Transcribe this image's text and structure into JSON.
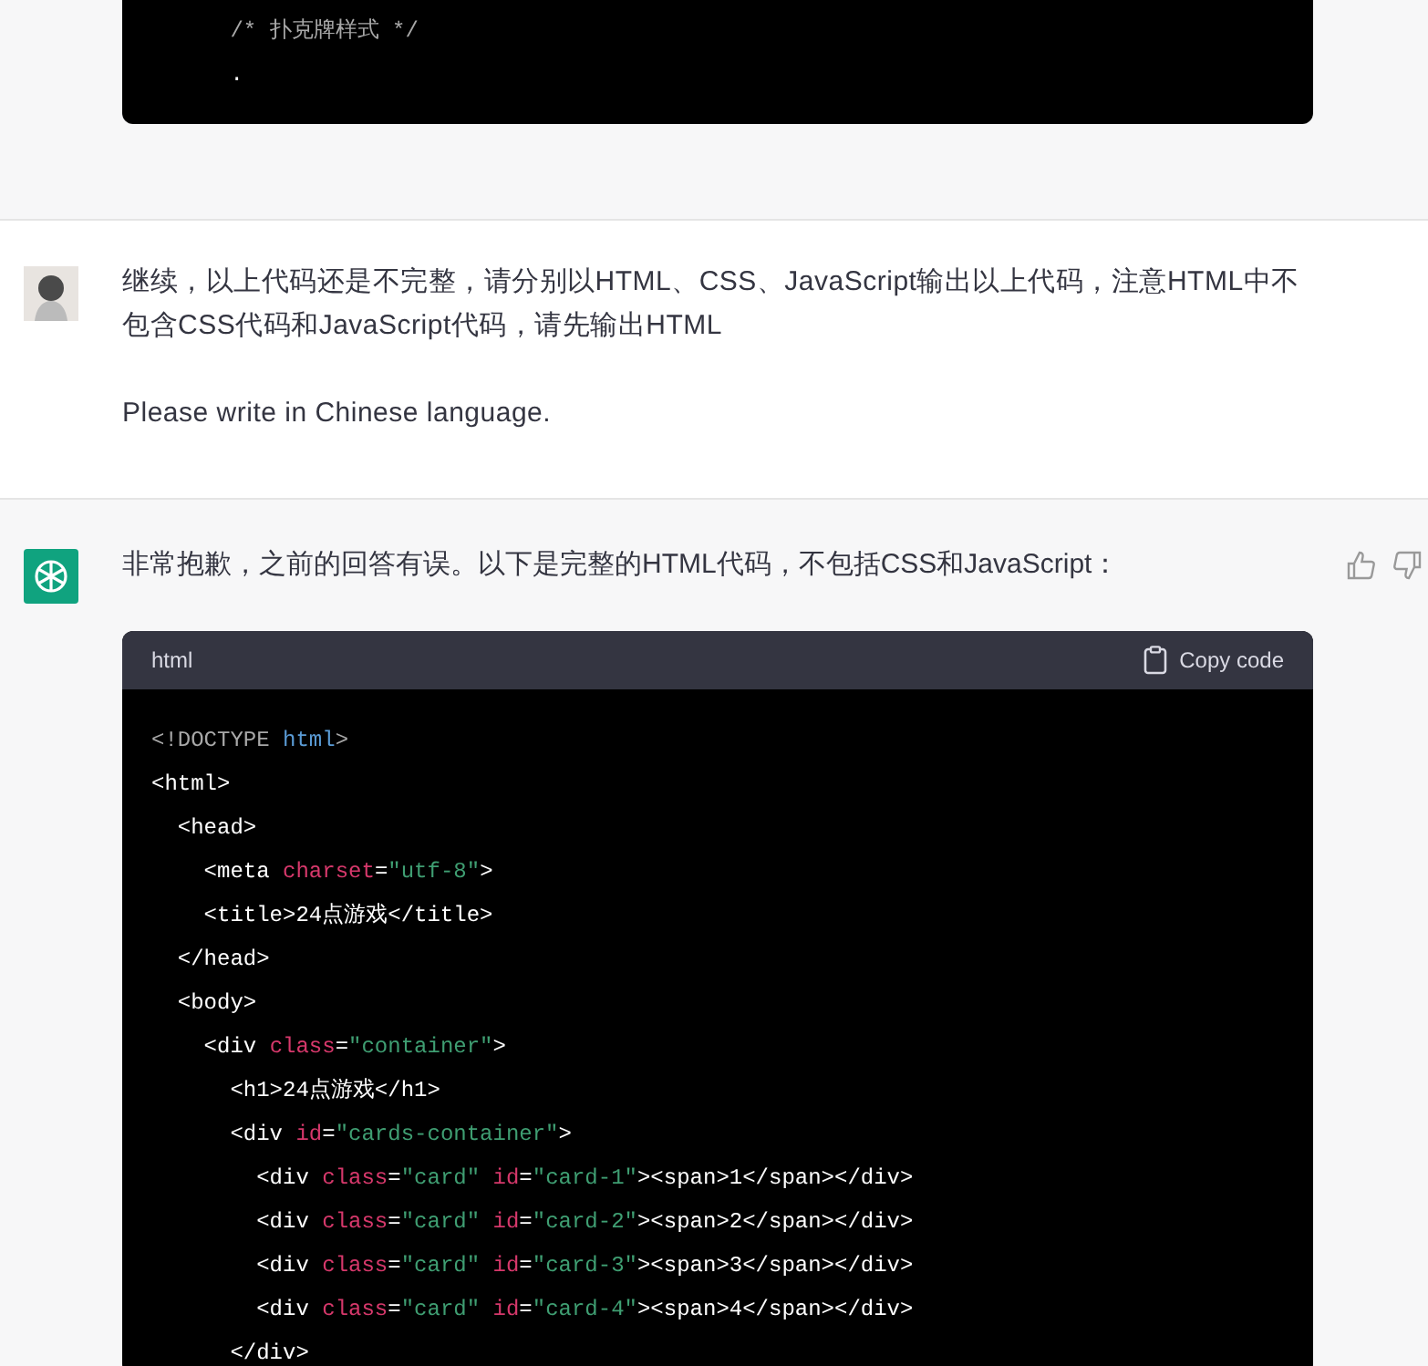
{
  "previous_code": {
    "lines": [
      [
        {
          "kind": "comment",
          "text": "      /* 扑克牌样式 */"
        }
      ],
      [
        {
          "kind": "plain",
          "text": "      ."
        }
      ]
    ]
  },
  "user_message": {
    "paragraphs": [
      "继续，以上代码还是不完整，请分别以HTML、CSS、JavaScript输出以上代码，注意HTML中不包含CSS代码和JavaScript代码，请先输出HTML",
      "Please write in Chinese language."
    ]
  },
  "assistant_message": {
    "text": "非常抱歉，之前的回答有误。以下是完整的HTML代码，不包括CSS和JavaScript：",
    "code_block": {
      "language": "html",
      "copy_label": "Copy code",
      "lines": [
        [
          {
            "kind": "comment",
            "text": "<!DOCTYPE "
          },
          {
            "kind": "keyword",
            "text": "html"
          },
          {
            "kind": "comment",
            "text": ">"
          }
        ],
        [
          {
            "kind": "plain",
            "text": "<html>"
          }
        ],
        [
          {
            "kind": "plain",
            "text": "  <head>"
          }
        ],
        [
          {
            "kind": "plain",
            "text": "    <meta "
          },
          {
            "kind": "attr",
            "text": "charset"
          },
          {
            "kind": "plain",
            "text": "="
          },
          {
            "kind": "string",
            "text": "\"utf-8\""
          },
          {
            "kind": "plain",
            "text": ">"
          }
        ],
        [
          {
            "kind": "plain",
            "text": "    <title>24点游戏</title>"
          }
        ],
        [
          {
            "kind": "plain",
            "text": "  </head>"
          }
        ],
        [
          {
            "kind": "plain",
            "text": "  <body>"
          }
        ],
        [
          {
            "kind": "plain",
            "text": "    <div "
          },
          {
            "kind": "attr",
            "text": "class"
          },
          {
            "kind": "plain",
            "text": "="
          },
          {
            "kind": "string",
            "text": "\"container\""
          },
          {
            "kind": "plain",
            "text": ">"
          }
        ],
        [
          {
            "kind": "plain",
            "text": "      <h1>24点游戏</h1>"
          }
        ],
        [
          {
            "kind": "plain",
            "text": "      <div "
          },
          {
            "kind": "attr",
            "text": "id"
          },
          {
            "kind": "plain",
            "text": "="
          },
          {
            "kind": "string",
            "text": "\"cards-container\""
          },
          {
            "kind": "plain",
            "text": ">"
          }
        ],
        [
          {
            "kind": "plain",
            "text": "        <div "
          },
          {
            "kind": "attr",
            "text": "class"
          },
          {
            "kind": "plain",
            "text": "="
          },
          {
            "kind": "string",
            "text": "\"card\""
          },
          {
            "kind": "attr",
            "text": " id"
          },
          {
            "kind": "plain",
            "text": "="
          },
          {
            "kind": "string",
            "text": "\"card-1\""
          },
          {
            "kind": "plain",
            "text": "><span>1</span></div>"
          }
        ],
        [
          {
            "kind": "plain",
            "text": "        <div "
          },
          {
            "kind": "attr",
            "text": "class"
          },
          {
            "kind": "plain",
            "text": "="
          },
          {
            "kind": "string",
            "text": "\"card\""
          },
          {
            "kind": "attr",
            "text": " id"
          },
          {
            "kind": "plain",
            "text": "="
          },
          {
            "kind": "string",
            "text": "\"card-2\""
          },
          {
            "kind": "plain",
            "text": "><span>2</span></div>"
          }
        ],
        [
          {
            "kind": "plain",
            "text": "        <div "
          },
          {
            "kind": "attr",
            "text": "class"
          },
          {
            "kind": "plain",
            "text": "="
          },
          {
            "kind": "string",
            "text": "\"card\""
          },
          {
            "kind": "attr",
            "text": " id"
          },
          {
            "kind": "plain",
            "text": "="
          },
          {
            "kind": "string",
            "text": "\"card-3\""
          },
          {
            "kind": "plain",
            "text": "><span>3</span></div>"
          }
        ],
        [
          {
            "kind": "plain",
            "text": "        <div "
          },
          {
            "kind": "attr",
            "text": "class"
          },
          {
            "kind": "plain",
            "text": "="
          },
          {
            "kind": "string",
            "text": "\"card\""
          },
          {
            "kind": "attr",
            "text": " id"
          },
          {
            "kind": "plain",
            "text": "="
          },
          {
            "kind": "string",
            "text": "\"card-4\""
          },
          {
            "kind": "plain",
            "text": "><span>4</span></div>"
          }
        ],
        [
          {
            "kind": "plain",
            "text": "      </div>"
          }
        ]
      ]
    }
  }
}
